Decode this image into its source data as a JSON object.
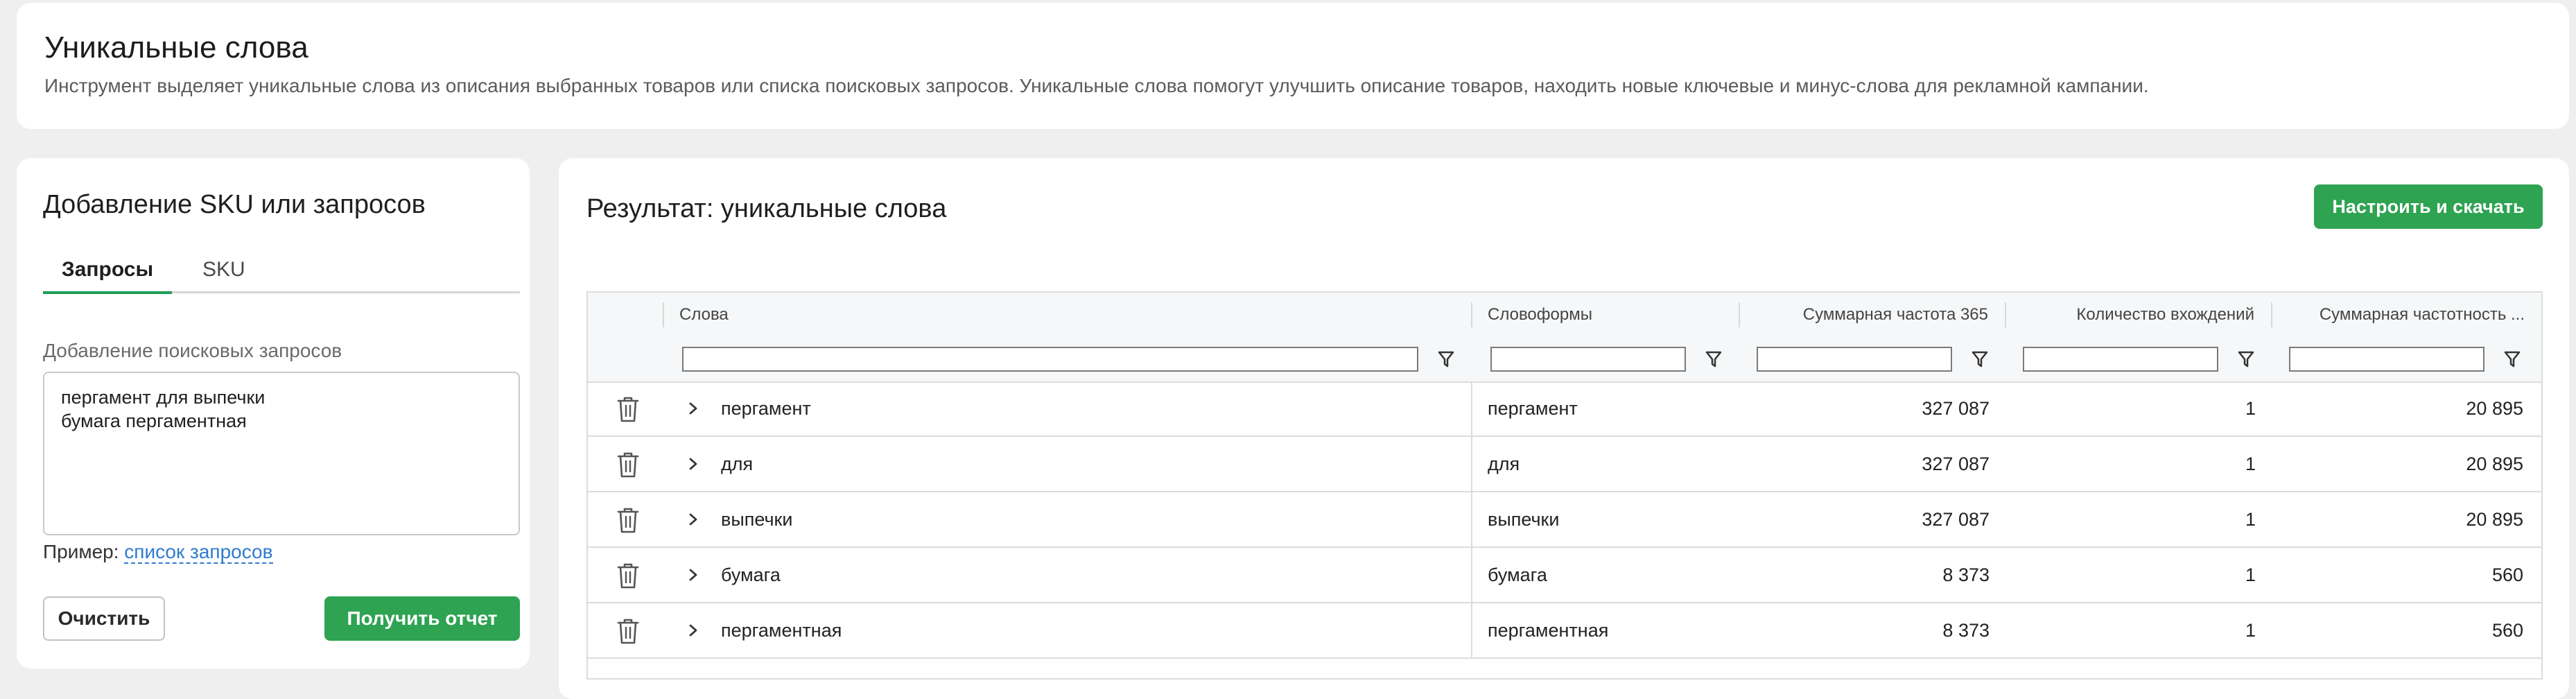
{
  "header": {
    "title": "Уникальные слова",
    "description": "Инструмент выделяет уникальные слова из описания выбранных товаров или списка поисковых запросов. Уникальные слова помогут улучшить описание товаров, находить новые ключевые и минус-слова для рекламной кампании."
  },
  "left_panel": {
    "title": "Добавление SKU или запросов",
    "tabs": [
      {
        "label": "Запросы",
        "active": true
      },
      {
        "label": "SKU",
        "active": false
      }
    ],
    "input_label": "Добавление поисковых запросов",
    "input_value": "пергамент для выпечки\nбумага пергаментная",
    "example_prefix": "Пример:",
    "example_link": "список запросов",
    "clear_label": "Очистить",
    "report_label": "Получить отчет"
  },
  "result": {
    "title": "Результат: уникальные слова",
    "download_label": "Настроить и скачать",
    "columns": [
      "Слова",
      "Словоформы",
      "Суммарная частота 365",
      "Количество вхождений",
      "Суммарная частотность ..."
    ],
    "rows": [
      {
        "word": "пергамент",
        "forms": "пергамент",
        "freq365": "327 087",
        "count": "1",
        "freq": "20 895"
      },
      {
        "word": "для",
        "forms": "для",
        "freq365": "327 087",
        "count": "1",
        "freq": "20 895"
      },
      {
        "word": "выпечки",
        "forms": "выпечки",
        "freq365": "327 087",
        "count": "1",
        "freq": "20 895"
      },
      {
        "word": "бумага",
        "forms": "бумага",
        "freq365": "8 373",
        "count": "1",
        "freq": "560"
      },
      {
        "word": "пергаментная",
        "forms": "пергаментная",
        "freq365": "8 373",
        "count": "1",
        "freq": "560"
      }
    ]
  },
  "icons": {
    "row_delete": "trash-icon",
    "row_expand": "chevron-right-icon",
    "column_filter": "filter-icon"
  },
  "colors": {
    "accent": "#2ea352",
    "link": "#2f7bd0",
    "background": "#efefef"
  }
}
